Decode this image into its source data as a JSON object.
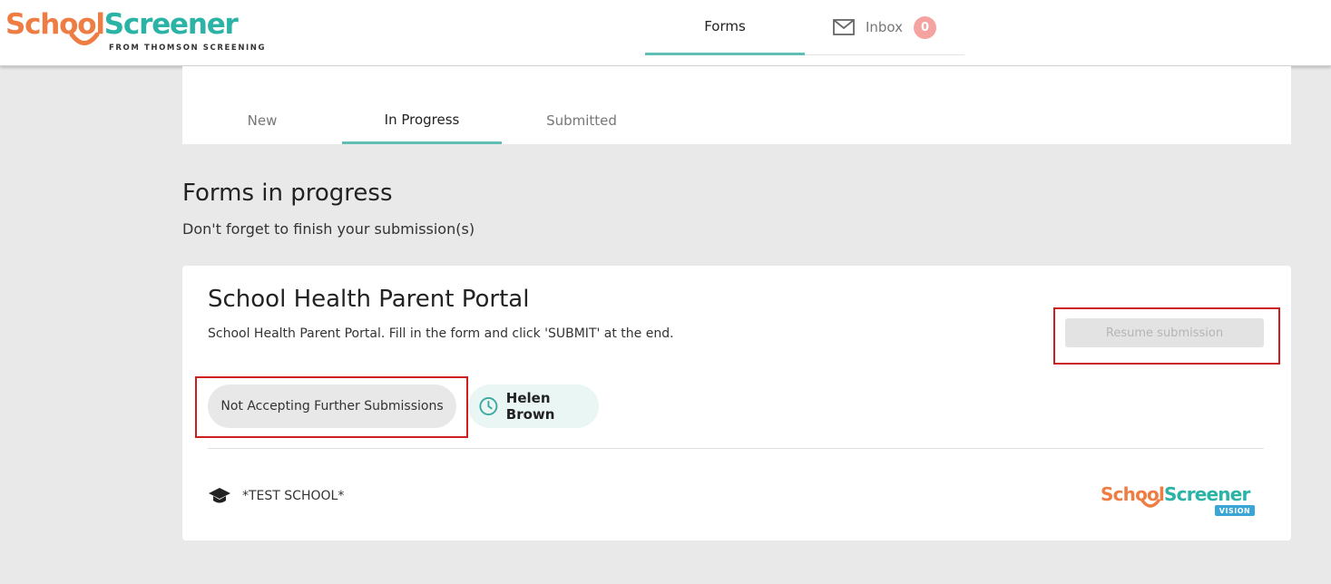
{
  "brand": {
    "name_part1": "School",
    "name_part2": "Screener",
    "tagline": "FROM THOMSON SCREENING"
  },
  "nav": {
    "forms_label": "Forms",
    "inbox_label": "Inbox",
    "inbox_count": "0"
  },
  "tabs": [
    {
      "label": "New"
    },
    {
      "label": "In Progress"
    },
    {
      "label": "Submitted"
    }
  ],
  "page": {
    "title": "Forms in progress",
    "subtitle": "Don't forget to finish your submission(s)"
  },
  "card": {
    "title": "School Health Parent Portal",
    "description": "School Health Parent Portal. Fill in the form and click 'SUBMIT' at the end.",
    "resume_label": "Resume submission",
    "status_label": "Not Accepting Further Submissions",
    "user_name": "Helen Brown",
    "school_name": "*TEST SCHOOL*",
    "vision_logo": {
      "part1": "School",
      "part2": "Screener",
      "tag": "VISION"
    }
  },
  "colors": {
    "brand_orange": "#ee7d43",
    "brand_teal": "#2bb3a6",
    "active_underline": "#5fbfb6",
    "badge": "#f4a3a0",
    "highlight_outline": "#cc1f1f"
  }
}
